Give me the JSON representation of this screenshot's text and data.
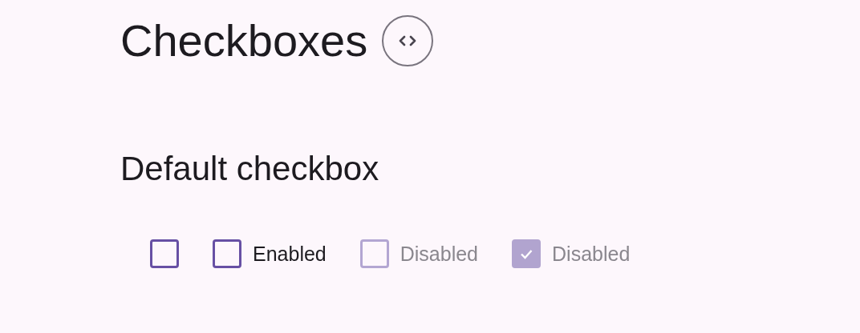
{
  "title": "Checkboxes",
  "section": {
    "heading": "Default checkbox",
    "checkboxes": [
      {
        "checked": false,
        "disabled": false
      },
      {
        "label": "Enabled",
        "checked": false,
        "disabled": false
      },
      {
        "label": "Disabled",
        "checked": false,
        "disabled": true
      },
      {
        "label": "Disabled",
        "checked": true,
        "disabled": true
      }
    ]
  }
}
